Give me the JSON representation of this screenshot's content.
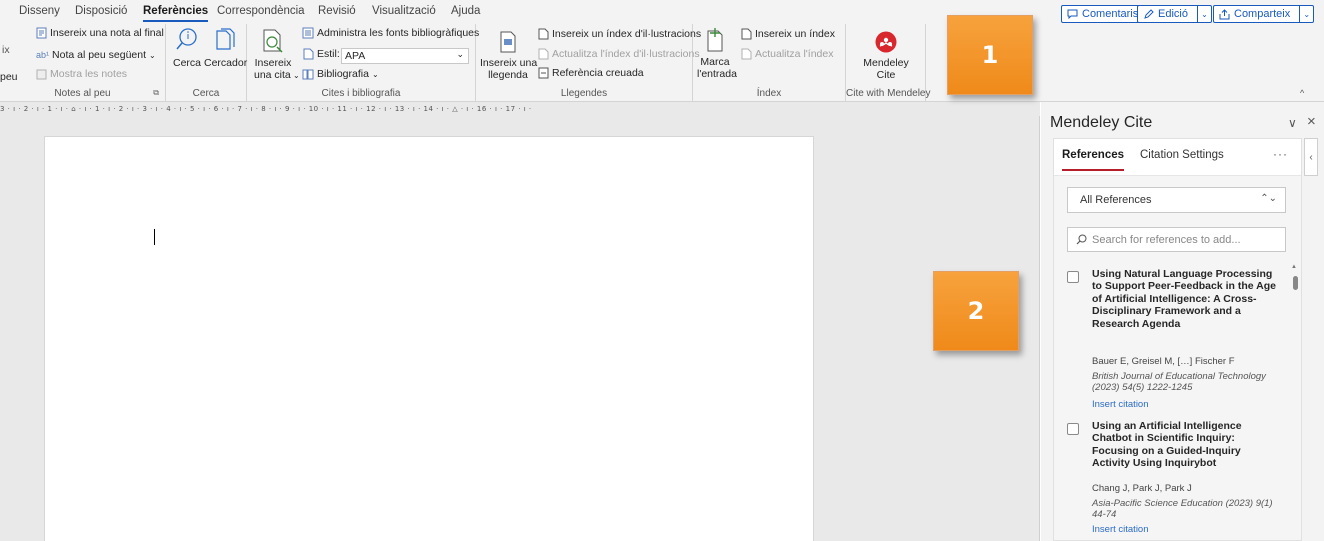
{
  "ribbon": {
    "tabs": [
      "Disseny",
      "Disposició",
      "Referències",
      "Correspondència",
      "Revisió",
      "Visualització",
      "Ajuda"
    ],
    "active_tab": "Referències",
    "comments_label": "Comentaris",
    "editing_label": "Edició",
    "share_label": "Comparteix",
    "footnotes": {
      "insert_endnote": "Insereix una nota al final",
      "next_footnote": "Nota al peu següent",
      "show_notes": "Mostra les notes",
      "cut_left_top": "ix",
      "cut_left_bottom": "peu",
      "group_label": "Notes al peu"
    },
    "search": {
      "search_label": "Cerca",
      "researcher_label": "Cercador",
      "group_label": "Cerca"
    },
    "citations": {
      "insert_citation_line1": "Insereix",
      "insert_citation_line2": "una cita",
      "manage_sources": "Administra les fonts bibliogràfiques",
      "style_label": "Estil:",
      "style_value": "APA",
      "bibliography": "Bibliografia",
      "group_label": "Cites i bibliografia"
    },
    "captions": {
      "insert_caption_line1": "Insereix una",
      "insert_caption_line2": "llegenda",
      "insert_table_of_figures": "Insereix un índex d'il·lustracions",
      "update_table": "Actualitza l'índex d'il·lustracions",
      "cross_reference": "Referència creuada",
      "group_label": "Llegendes"
    },
    "index": {
      "mark_entry_line1": "Marca",
      "mark_entry_line2": "l'entrada",
      "insert_index": "Insereix un índex",
      "update_index": "Actualitza l'índex",
      "group_label": "Índex"
    },
    "mendeley": {
      "label_line1": "Mendeley",
      "label_line2": "Cite",
      "group_label": "Cite with Mendeley"
    }
  },
  "ruler": {
    "ticks": "3 · ı · 2 · ı · 1 · ı · ⌂ · ı · 1 · ı · 2 · ı · 3 · ı · 4 · ı · 5 · ı · 6 · ı · 7 · ı · 8 · ı · 9 · ı · 10 · ı · 11 · ı · 12 · ı · 13 · ı · 14 · ı · △ · ı · 16 · ı · 17 · ı ·"
  },
  "callouts": [
    "1",
    "2"
  ],
  "pane": {
    "title": "Mendeley Cite",
    "tabs": [
      "References",
      "Citation Settings"
    ],
    "active_tab": "References",
    "more": "···",
    "filter_value": "All References",
    "search_placeholder": "Search for references to add...",
    "references": [
      {
        "title": "Using Natural Language Processing to Support Peer-Feedback in the Age of Artificial Intelligence: A Cross-Disciplinary Framework and a Research Agenda",
        "authors": "Bauer E, Greisel M, […] Fischer F",
        "journal": "British Journal of Educational Technology (2023) 54(5) 1222-1245",
        "action": "Insert citation"
      },
      {
        "title": "Using an Artificial Intelligence Chatbot in Scientific Inquiry: Focusing on a Guided-Inquiry Activity Using Inquirybot",
        "authors": "Chang J, Park J, Park J",
        "journal": "Asia-Pacific Science Education (2023) 9(1) 44-74",
        "action": "Insert citation"
      }
    ]
  },
  "colors": {
    "accent_blue": "#185abd",
    "mendeley_red": "#d9272e",
    "callout_orange": "#f59a31",
    "link_blue": "#2b6cc4"
  },
  "icons": [
    "comment-icon",
    "pencil-icon",
    "share-icon",
    "endnote-icon",
    "next-footnote-icon",
    "show-notes-icon",
    "search-icon",
    "researcher-icon",
    "insert-citation-icon",
    "manage-sources-icon",
    "style-icon",
    "bibliography-icon",
    "insert-caption-icon",
    "table-of-figures-icon",
    "cross-reference-icon",
    "mark-entry-icon",
    "insert-index-icon",
    "mendeley-logo-icon",
    "close-icon",
    "chevron-down-icon"
  ]
}
